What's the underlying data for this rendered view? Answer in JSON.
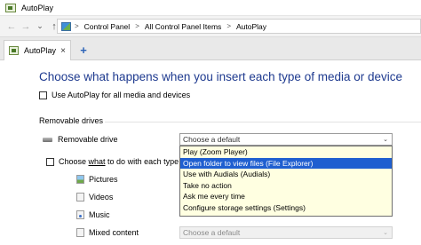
{
  "window": {
    "title": "AutoPlay"
  },
  "address": {
    "crumbs": [
      "Control Panel",
      "All Control Panel Items",
      "AutoPlay"
    ],
    "separator": ">",
    "back": "←",
    "forward": "→",
    "history": "⌄",
    "up": "↑"
  },
  "tabs": [
    {
      "label": "AutoPlay",
      "close": "×"
    }
  ],
  "new_tab": "+",
  "main": {
    "heading": "Choose what happens when you insert each type of media or device",
    "use_autoplay": {
      "label": "Use AutoPlay for all media and devices",
      "checked": false
    },
    "section": "Removable drives",
    "removable_drive": {
      "label": "Removable drive",
      "value": "Choose a default"
    },
    "choose_what_prefix": "Choose ",
    "choose_what_underlined": "what",
    "choose_what_suffix": " to do with each type of m",
    "media": [
      {
        "label": "Pictures",
        "icon": "pictures-icon"
      },
      {
        "label": "Videos",
        "icon": "videos-icon"
      },
      {
        "label": "Music",
        "icon": "music-icon"
      },
      {
        "label": "Mixed content",
        "icon": "mixed-content-icon",
        "value": "Choose a default"
      }
    ]
  },
  "dropdown": {
    "options": [
      "Play (Zoom Player)",
      "Open folder to view files (File Explorer)",
      "Use with Audials (Audials)",
      "Take no action",
      "Ask me every time",
      "Configure storage settings (Settings)"
    ],
    "selected_index": 1
  },
  "colors": {
    "heading": "#1e3a8f",
    "selection": "#1f5fd0",
    "list_bg": "#ffffe1"
  }
}
